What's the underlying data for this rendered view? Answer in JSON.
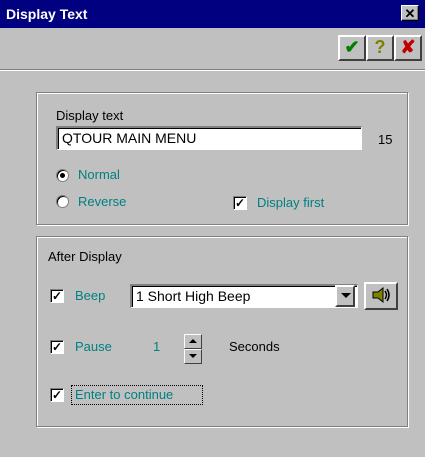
{
  "window": {
    "title": "Display Text",
    "close_glyph": "✕"
  },
  "toolbar": {
    "ok_icon": "check-icon",
    "help_icon": "question-icon",
    "cancel_icon": "x-icon",
    "ok_glyph": "✔",
    "help_glyph": "?",
    "cancel_glyph": "✘",
    "colors": {
      "ok": "#008000",
      "help": "#808000",
      "cancel": "#c00000"
    }
  },
  "display_group": {
    "label": "Display text",
    "text_value": "QTOUR MAIN MENU",
    "char_count": "15",
    "radios": [
      {
        "label": "Normal",
        "checked": true
      },
      {
        "label": "Reverse",
        "checked": false
      }
    ],
    "display_first": {
      "label": "Display first",
      "checked": true
    }
  },
  "after_group": {
    "label": "After Display",
    "beep": {
      "label": "Beep",
      "checked": true,
      "selected": "1 Short High Beep"
    },
    "pause": {
      "label": "Pause",
      "checked": true,
      "value": "1",
      "unit": "Seconds"
    },
    "enter": {
      "label": "Enter to continue",
      "checked": true
    }
  }
}
